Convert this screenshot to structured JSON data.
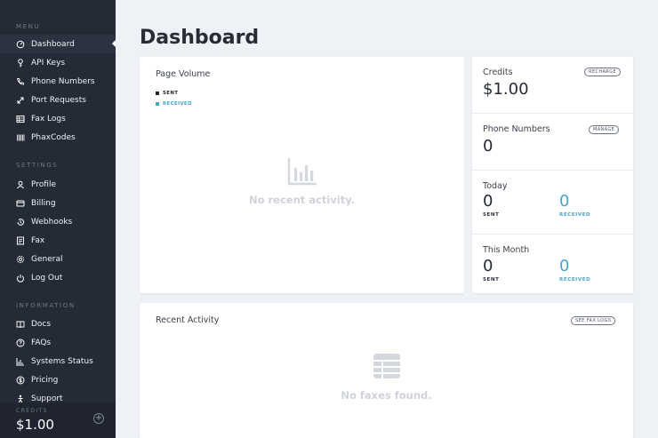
{
  "sidebar": {
    "sections": {
      "menu": "MENU",
      "settings": "SETTINGS",
      "information": "INFORMATION"
    },
    "menu_items": [
      {
        "label": "Dashboard",
        "icon": "dashboard-icon"
      },
      {
        "label": "API Keys",
        "icon": "key-icon"
      },
      {
        "label": "Phone Numbers",
        "icon": "phone-icon"
      },
      {
        "label": "Port Requests",
        "icon": "transfer-icon"
      },
      {
        "label": "Fax Logs",
        "icon": "list-icon"
      },
      {
        "label": "PhaxCodes",
        "icon": "barcode-icon"
      }
    ],
    "settings_items": [
      {
        "label": "Profile",
        "icon": "user-icon"
      },
      {
        "label": "Billing",
        "icon": "credit-card-icon"
      },
      {
        "label": "Webhooks",
        "icon": "history-icon"
      },
      {
        "label": "Fax",
        "icon": "fax-icon"
      },
      {
        "label": "General",
        "icon": "gear-icon"
      },
      {
        "label": "Log Out",
        "icon": "power-icon"
      }
    ],
    "info_items": [
      {
        "label": "Docs",
        "icon": "book-icon"
      },
      {
        "label": "FAQs",
        "icon": "question-icon"
      },
      {
        "label": "Systems Status",
        "icon": "bar-chart-icon"
      },
      {
        "label": "Pricing",
        "icon": "dollar-icon"
      },
      {
        "label": "Support",
        "icon": "support-icon"
      }
    ],
    "credits_label": "CREDITS",
    "credits_value": "$1.00"
  },
  "page_title": "Dashboard",
  "page_volume": {
    "title": "Page Volume",
    "legend_sent": "SENT",
    "legend_received": "RECEIVED",
    "empty_text": "No recent activity."
  },
  "credits_card": {
    "title": "Credits",
    "value": "$1.00",
    "action": "RECHARGE"
  },
  "phone_numbers_card": {
    "title": "Phone Numbers",
    "value": "0",
    "action": "MANAGE"
  },
  "today_card": {
    "title": "Today",
    "sent_value": "0",
    "sent_label": "SENT",
    "received_value": "0",
    "received_label": "RECEIVED"
  },
  "month_card": {
    "title": "This Month",
    "sent_value": "0",
    "sent_label": "SENT",
    "received_value": "0",
    "received_label": "RECEIVED"
  },
  "recent_activity": {
    "title": "Recent Activity",
    "action": "SEE FAX LOGS",
    "empty_text": "No faxes found."
  },
  "colors": {
    "sidebar_bg": "#252b36",
    "accent_blue": "#4aa3c9",
    "page_bg": "#eef1f5"
  }
}
